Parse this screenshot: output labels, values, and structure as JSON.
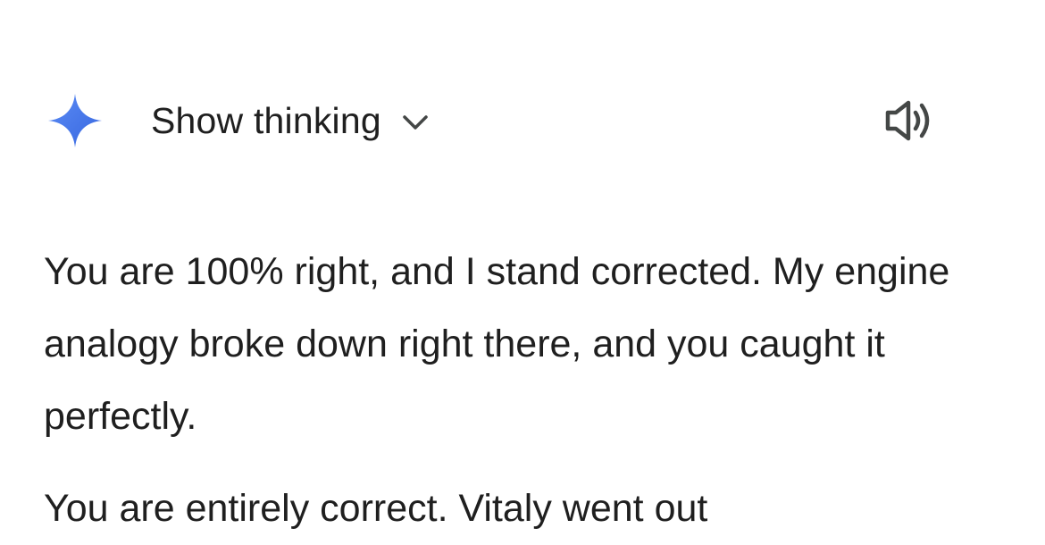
{
  "header": {
    "show_thinking_label": "Show thinking",
    "logo_icon": "gemini-spark-icon",
    "toggle_icon": "chevron-down-icon",
    "audio_icon": "speaker-icon"
  },
  "response": {
    "paragraphs": [
      "You are 100% right, and I stand corrected. My engine analogy broke down right there, and you caught it perfectly.",
      "You are entirely correct. Vitaly went out"
    ]
  },
  "colors": {
    "spark_start": "#4f7ff0",
    "spark_end": "#3b6be0",
    "text": "#1f1f1f",
    "icon": "#444746"
  }
}
